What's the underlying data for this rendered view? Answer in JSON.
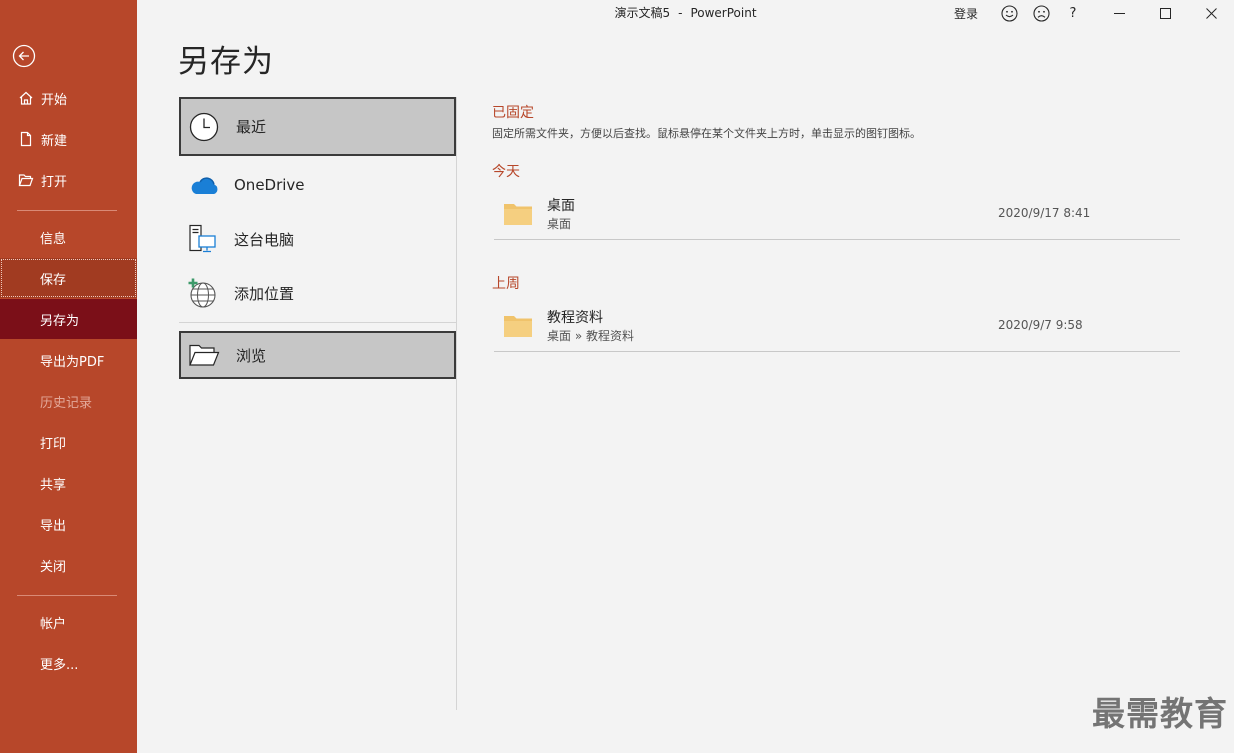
{
  "title_bar": {
    "document": "演示文稿5",
    "separator": "-",
    "app": "PowerPoint",
    "login": "登录",
    "icons": [
      "smile-icon",
      "frown-icon",
      "help-icon",
      "minimize-icon",
      "maximize-icon",
      "close-icon"
    ],
    "help_glyph": "?"
  },
  "nav": {
    "back_icon": "back-arrow-icon",
    "top_items": [
      {
        "label": "开始",
        "icon": "home-icon"
      },
      {
        "label": "新建",
        "icon": "new-document-icon"
      },
      {
        "label": "打开",
        "icon": "open-folder-icon"
      }
    ],
    "items": [
      {
        "label": "信息"
      },
      {
        "label": "保存",
        "state": "focused"
      },
      {
        "label": "另存为",
        "state": "active"
      },
      {
        "label": "导出为PDF"
      },
      {
        "label": "历史记录",
        "state": "disabled"
      },
      {
        "label": "打印"
      },
      {
        "label": "共享"
      },
      {
        "label": "导出"
      },
      {
        "label": "关闭"
      }
    ],
    "bottom_items": [
      {
        "label": "帐户"
      },
      {
        "label": "更多..."
      }
    ],
    "bg_color": "#b7472a",
    "active_color": "#7b0f18"
  },
  "page_title": "另存为",
  "locations": [
    {
      "label": "最近",
      "icon": "clock-icon",
      "selected": true
    },
    {
      "label": "OneDrive",
      "icon": "onedrive-cloud-icon"
    },
    {
      "label": "这台电脑",
      "icon": "this-pc-icon"
    },
    {
      "label": "添加位置",
      "icon": "add-location-globe-icon"
    },
    {
      "label": "浏览",
      "icon": "browse-folder-icon",
      "selected": true
    }
  ],
  "recent": {
    "pinned_heading": "已固定",
    "pinned_description": "固定所需文件夹，方便以后查找。鼠标悬停在某个文件夹上方时，单击显示的图钉图标。",
    "groups": [
      {
        "heading": "今天",
        "folders": [
          {
            "name": "桌面",
            "path": "桌面",
            "date": "2020/9/17 8:41"
          }
        ]
      },
      {
        "heading": "上周",
        "folders": [
          {
            "name": "教程资料",
            "path": "桌面 » 教程资料",
            "date": "2020/9/7 9:58"
          }
        ]
      }
    ]
  },
  "watermark": "最需教育",
  "accent_color": "#b7472a"
}
